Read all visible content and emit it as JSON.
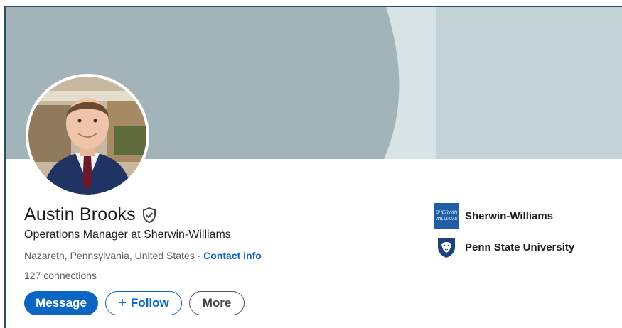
{
  "profile": {
    "name": "Austin Brooks",
    "headline": "Operations Manager at Sherwin-Williams",
    "location": "Nazareth, Pennsylvania, United States",
    "separator": " · ",
    "contact_label": "Contact info",
    "connections": "127 connections"
  },
  "actions": {
    "message_label": "Message",
    "follow_plus": "+",
    "follow_label": "Follow",
    "more_label": "More"
  },
  "organizations": [
    {
      "name": "Sherwin-Williams",
      "icon": "sherwin-williams-logo",
      "logo_text_1": "SHERWIN",
      "logo_text_2": "WILLIAMS"
    },
    {
      "name": "Penn State University",
      "icon": "penn-state-shield-logo"
    }
  ],
  "colors": {
    "accent": "#0a66c2",
    "banner_dark": "#a2b4b9",
    "banner_light": "#c3d2d6",
    "banner_mid": "#d8e3e6",
    "sherwin_blue": "#1f5fa6",
    "pennstate_navy": "#1e407c"
  }
}
